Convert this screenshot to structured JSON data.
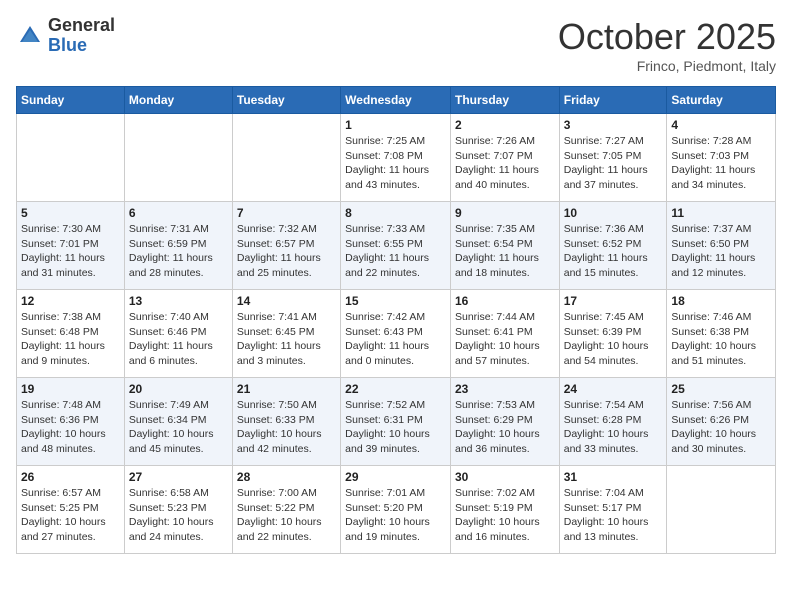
{
  "header": {
    "logo_general": "General",
    "logo_blue": "Blue",
    "month_title": "October 2025",
    "subtitle": "Frinco, Piedmont, Italy"
  },
  "days_of_week": [
    "Sunday",
    "Monday",
    "Tuesday",
    "Wednesday",
    "Thursday",
    "Friday",
    "Saturday"
  ],
  "weeks": [
    [
      {
        "day": "",
        "info": ""
      },
      {
        "day": "",
        "info": ""
      },
      {
        "day": "",
        "info": ""
      },
      {
        "day": "1",
        "info": "Sunrise: 7:25 AM\nSunset: 7:08 PM\nDaylight: 11 hours and 43 minutes."
      },
      {
        "day": "2",
        "info": "Sunrise: 7:26 AM\nSunset: 7:07 PM\nDaylight: 11 hours and 40 minutes."
      },
      {
        "day": "3",
        "info": "Sunrise: 7:27 AM\nSunset: 7:05 PM\nDaylight: 11 hours and 37 minutes."
      },
      {
        "day": "4",
        "info": "Sunrise: 7:28 AM\nSunset: 7:03 PM\nDaylight: 11 hours and 34 minutes."
      }
    ],
    [
      {
        "day": "5",
        "info": "Sunrise: 7:30 AM\nSunset: 7:01 PM\nDaylight: 11 hours and 31 minutes."
      },
      {
        "day": "6",
        "info": "Sunrise: 7:31 AM\nSunset: 6:59 PM\nDaylight: 11 hours and 28 minutes."
      },
      {
        "day": "7",
        "info": "Sunrise: 7:32 AM\nSunset: 6:57 PM\nDaylight: 11 hours and 25 minutes."
      },
      {
        "day": "8",
        "info": "Sunrise: 7:33 AM\nSunset: 6:55 PM\nDaylight: 11 hours and 22 minutes."
      },
      {
        "day": "9",
        "info": "Sunrise: 7:35 AM\nSunset: 6:54 PM\nDaylight: 11 hours and 18 minutes."
      },
      {
        "day": "10",
        "info": "Sunrise: 7:36 AM\nSunset: 6:52 PM\nDaylight: 11 hours and 15 minutes."
      },
      {
        "day": "11",
        "info": "Sunrise: 7:37 AM\nSunset: 6:50 PM\nDaylight: 11 hours and 12 minutes."
      }
    ],
    [
      {
        "day": "12",
        "info": "Sunrise: 7:38 AM\nSunset: 6:48 PM\nDaylight: 11 hours and 9 minutes."
      },
      {
        "day": "13",
        "info": "Sunrise: 7:40 AM\nSunset: 6:46 PM\nDaylight: 11 hours and 6 minutes."
      },
      {
        "day": "14",
        "info": "Sunrise: 7:41 AM\nSunset: 6:45 PM\nDaylight: 11 hours and 3 minutes."
      },
      {
        "day": "15",
        "info": "Sunrise: 7:42 AM\nSunset: 6:43 PM\nDaylight: 11 hours and 0 minutes."
      },
      {
        "day": "16",
        "info": "Sunrise: 7:44 AM\nSunset: 6:41 PM\nDaylight: 10 hours and 57 minutes."
      },
      {
        "day": "17",
        "info": "Sunrise: 7:45 AM\nSunset: 6:39 PM\nDaylight: 10 hours and 54 minutes."
      },
      {
        "day": "18",
        "info": "Sunrise: 7:46 AM\nSunset: 6:38 PM\nDaylight: 10 hours and 51 minutes."
      }
    ],
    [
      {
        "day": "19",
        "info": "Sunrise: 7:48 AM\nSunset: 6:36 PM\nDaylight: 10 hours and 48 minutes."
      },
      {
        "day": "20",
        "info": "Sunrise: 7:49 AM\nSunset: 6:34 PM\nDaylight: 10 hours and 45 minutes."
      },
      {
        "day": "21",
        "info": "Sunrise: 7:50 AM\nSunset: 6:33 PM\nDaylight: 10 hours and 42 minutes."
      },
      {
        "day": "22",
        "info": "Sunrise: 7:52 AM\nSunset: 6:31 PM\nDaylight: 10 hours and 39 minutes."
      },
      {
        "day": "23",
        "info": "Sunrise: 7:53 AM\nSunset: 6:29 PM\nDaylight: 10 hours and 36 minutes."
      },
      {
        "day": "24",
        "info": "Sunrise: 7:54 AM\nSunset: 6:28 PM\nDaylight: 10 hours and 33 minutes."
      },
      {
        "day": "25",
        "info": "Sunrise: 7:56 AM\nSunset: 6:26 PM\nDaylight: 10 hours and 30 minutes."
      }
    ],
    [
      {
        "day": "26",
        "info": "Sunrise: 6:57 AM\nSunset: 5:25 PM\nDaylight: 10 hours and 27 minutes."
      },
      {
        "day": "27",
        "info": "Sunrise: 6:58 AM\nSunset: 5:23 PM\nDaylight: 10 hours and 24 minutes."
      },
      {
        "day": "28",
        "info": "Sunrise: 7:00 AM\nSunset: 5:22 PM\nDaylight: 10 hours and 22 minutes."
      },
      {
        "day": "29",
        "info": "Sunrise: 7:01 AM\nSunset: 5:20 PM\nDaylight: 10 hours and 19 minutes."
      },
      {
        "day": "30",
        "info": "Sunrise: 7:02 AM\nSunset: 5:19 PM\nDaylight: 10 hours and 16 minutes."
      },
      {
        "day": "31",
        "info": "Sunrise: 7:04 AM\nSunset: 5:17 PM\nDaylight: 10 hours and 13 minutes."
      },
      {
        "day": "",
        "info": ""
      }
    ]
  ]
}
